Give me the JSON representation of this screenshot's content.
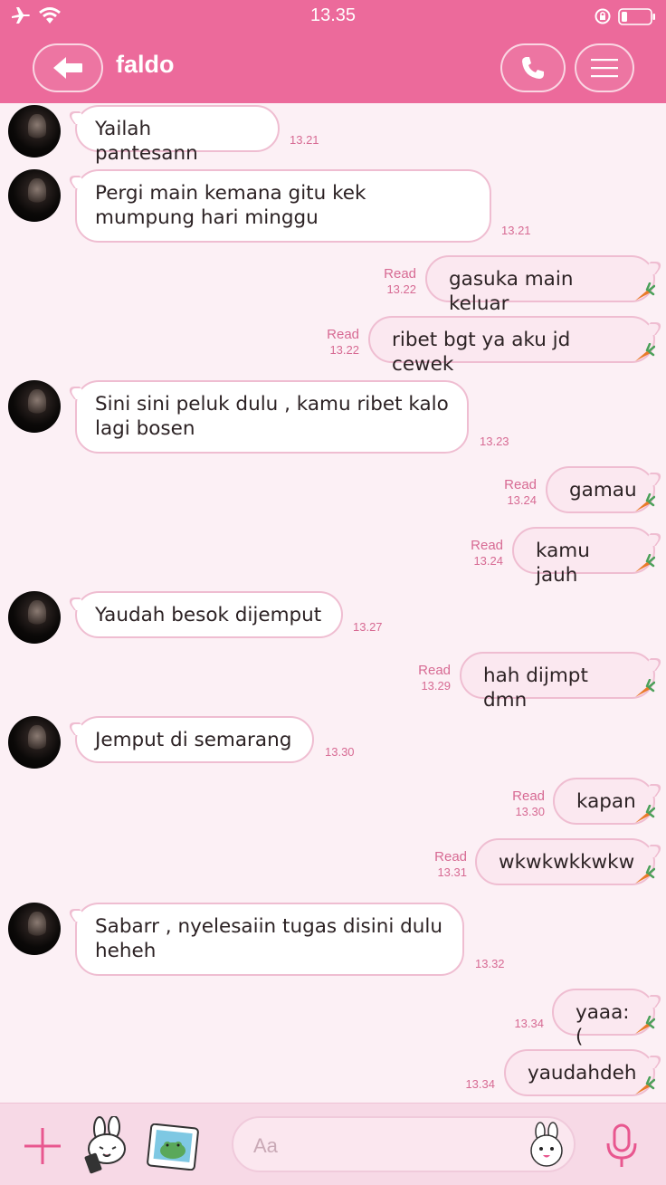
{
  "status_bar": {
    "time": "13.35"
  },
  "header": {
    "contact_name": "faldo"
  },
  "messages": [
    {
      "side": "in",
      "text": "Yailah pantesann",
      "time": "13.21"
    },
    {
      "side": "in",
      "text": "Pergi main kemana gitu kek mumpung hari minggu",
      "time": "13.21"
    },
    {
      "side": "out",
      "text": "gasuka main keluar",
      "read": "Read",
      "time": "13.22"
    },
    {
      "side": "out",
      "text": "ribet bgt ya aku jd cewek",
      "read": "Read",
      "time": "13.22"
    },
    {
      "side": "in",
      "text": "Sini sini peluk dulu , kamu ribet kalo lagi bosen",
      "time": "13.23"
    },
    {
      "side": "out",
      "text": "gamau",
      "read": "Read",
      "time": "13.24"
    },
    {
      "side": "out",
      "text": "kamu jauh",
      "read": "Read",
      "time": "13.24"
    },
    {
      "side": "in",
      "text": "Yaudah besok dijemput",
      "time": "13.27"
    },
    {
      "side": "out",
      "text": "hah dijmpt dmn",
      "read": "Read",
      "time": "13.29"
    },
    {
      "side": "in",
      "text": "Jemput di semarang",
      "time": "13.30"
    },
    {
      "side": "out",
      "text": "kapan",
      "read": "Read",
      "time": "13.30"
    },
    {
      "side": "out",
      "text": "wkwkwkkwkw",
      "read": "Read",
      "time": "13.31"
    },
    {
      "side": "in",
      "text": "Sabarr , nyelesaiin tugas disini dulu heheh",
      "time": "13.32"
    },
    {
      "side": "out",
      "text": "yaaa:(",
      "time": "13.34"
    },
    {
      "side": "out",
      "text": "yaudahdeh",
      "time": "13.34"
    }
  ],
  "input": {
    "placeholder": "Aa"
  },
  "colors": {
    "header": "#ec6a9b",
    "chat_background": "#fcf0f5",
    "bubble_border": "#efbdd1",
    "accent": "#e8578f"
  }
}
